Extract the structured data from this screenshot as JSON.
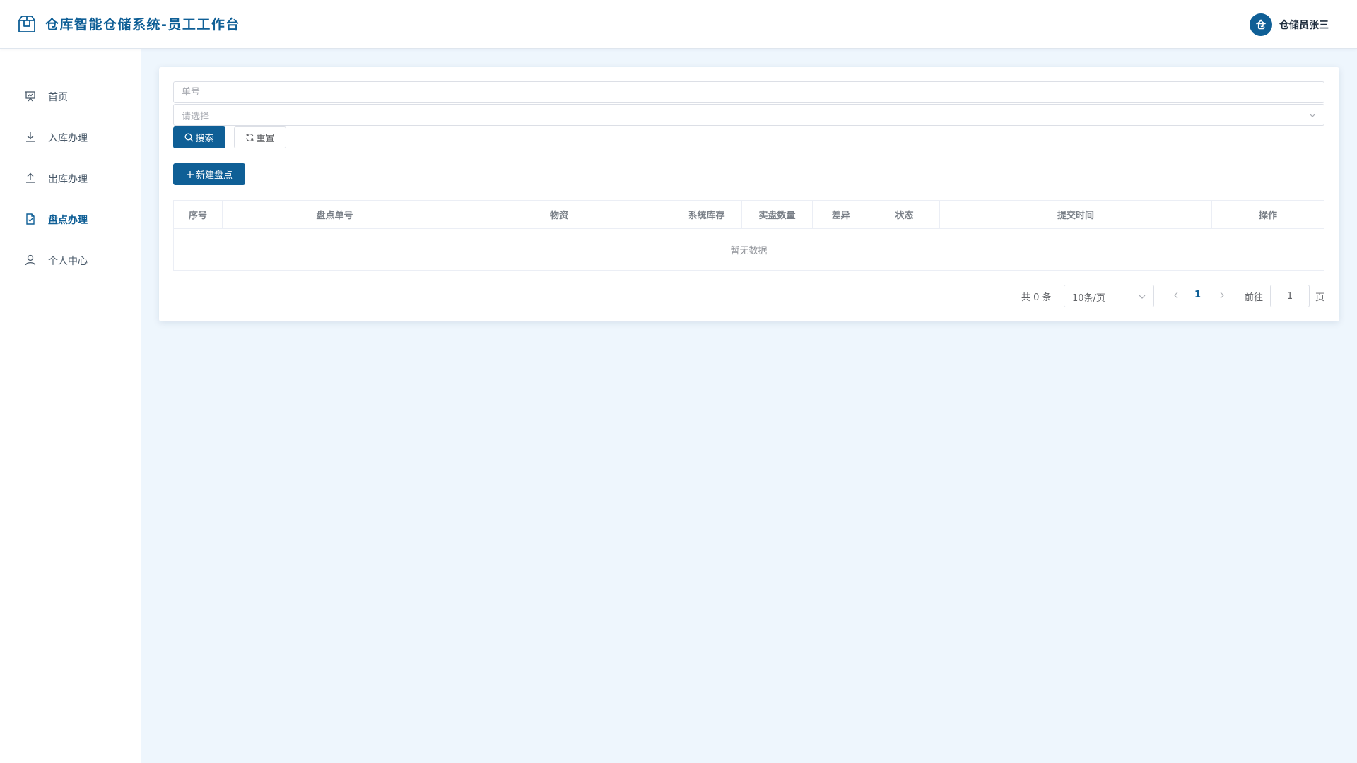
{
  "app": {
    "title": "仓库智能仓储系统-员工工作台"
  },
  "user": {
    "avatar_text": "仓",
    "name": "仓储员张三"
  },
  "sidebar": {
    "items": [
      {
        "label": "首页",
        "icon": "presentation-icon",
        "active": false
      },
      {
        "label": "入库办理",
        "icon": "download-icon",
        "active": false
      },
      {
        "label": "出库办理",
        "icon": "upload-icon",
        "active": false
      },
      {
        "label": "盘点办理",
        "icon": "document-check-icon",
        "active": true
      },
      {
        "label": "个人中心",
        "icon": "user-icon",
        "active": false
      }
    ]
  },
  "search": {
    "order_no_placeholder": "单号",
    "status_placeholder": "请选择",
    "search_label": "搜索",
    "reset_label": "重置"
  },
  "actions": {
    "new_label": "新建盘点"
  },
  "table": {
    "columns": [
      "序号",
      "盘点单号",
      "物资",
      "系统库存",
      "实盘数量",
      "差异",
      "状态",
      "提交时间",
      "操作"
    ],
    "rows": [],
    "empty_text": "暂无数据"
  },
  "pagination": {
    "total_text": "共 0 条",
    "page_size": "10条/页",
    "current_page": "1",
    "goto_label": "前往",
    "goto_value": "1",
    "page_unit": "页"
  },
  "colors": {
    "primary": "#0f5f96",
    "background": "#eef6fd"
  }
}
